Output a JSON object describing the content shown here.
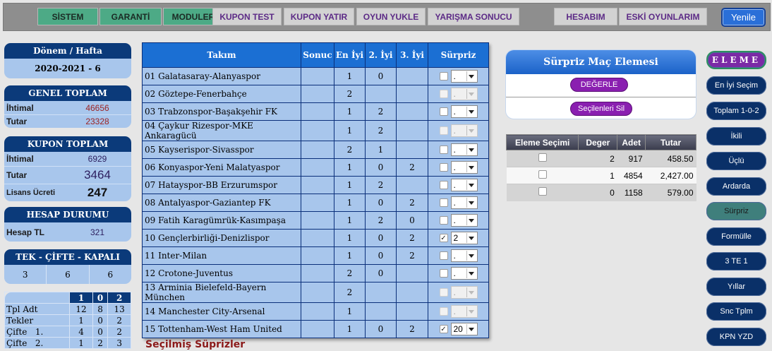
{
  "nav": {
    "left_buttons": [
      {
        "label": "SİSTEM",
        "style": "green"
      },
      {
        "label": "GARANTİ",
        "style": "green"
      },
      {
        "label": "MODULER",
        "style": "green"
      },
      {
        "label": "KUPON TEST",
        "style": "grey"
      },
      {
        "label": "KUPON YATIR",
        "style": "grey"
      },
      {
        "label": "OYUN YUKLE",
        "style": "grey"
      },
      {
        "label": "YARIŞMA SONUCU",
        "style": "grey"
      }
    ],
    "right_buttons": [
      {
        "label": "HESABIM"
      },
      {
        "label": "ESKİ OYUNLARIM"
      }
    ],
    "refresh_label": "Yenile"
  },
  "left": {
    "period": {
      "title": "Dönem / Hafta",
      "value": "2020-2021 - 6"
    },
    "general_total": {
      "title": "GENEL TOPLAM",
      "rows": [
        {
          "key": "İhtimal",
          "value": "46656"
        },
        {
          "key": "Tutar",
          "value": "23328"
        }
      ]
    },
    "coupon_total": {
      "title": "KUPON TOPLAM",
      "rows": [
        {
          "key": "İhtimal",
          "value": "6929"
        },
        {
          "key": "Tutar",
          "value": "3464"
        },
        {
          "key": "Lisans Ücreti",
          "value": "247"
        }
      ]
    },
    "account": {
      "title": "HESAP DURUMU",
      "key": "Hesap TL",
      "value": "321"
    },
    "single_double": {
      "title": "TEK - ÇİFTE - KAPALI",
      "values": [
        "3",
        "6",
        "6"
      ]
    },
    "tpl": {
      "headers": [
        "",
        "1",
        "0",
        "2"
      ],
      "rows": [
        [
          "Tpl Adt",
          "12",
          "8",
          "13"
        ],
        [
          "Tekler",
          "1",
          "0",
          "2"
        ],
        [
          "Çifte   1.",
          "4",
          "0",
          "2"
        ],
        [
          "Çifte   2.",
          "1",
          "2",
          "3"
        ]
      ]
    }
  },
  "main": {
    "headers": [
      "Takım",
      "Sonuc",
      "En İyi",
      "2. İyi",
      "3. İyi",
      "Sürpriz"
    ],
    "rows": [
      {
        "team": "01 Galatasaray-Alanyaspor",
        "sonuc": "",
        "best": "1",
        "second": "0",
        "third": "",
        "checked": false,
        "disabled": false,
        "value": "."
      },
      {
        "team": "02 Göztepe-Fenerbahçe",
        "sonuc": "",
        "best": "2",
        "second": "",
        "third": "",
        "checked": false,
        "disabled": true,
        "value": "."
      },
      {
        "team": "03 Trabzonspor-Başakşehir FK",
        "sonuc": "",
        "best": "1",
        "second": "2",
        "third": "",
        "checked": false,
        "disabled": false,
        "value": "."
      },
      {
        "team": "04 Çaykur Rizespor-MKE Ankaragücü",
        "sonuc": "",
        "best": "1",
        "second": "2",
        "third": "",
        "checked": false,
        "disabled": true,
        "value": "."
      },
      {
        "team": "05 Kayserispor-Sivasspor",
        "sonuc": "",
        "best": "2",
        "second": "1",
        "third": "",
        "checked": false,
        "disabled": false,
        "value": "."
      },
      {
        "team": "06 Konyaspor-Yeni Malatyaspor",
        "sonuc": "",
        "best": "1",
        "second": "0",
        "third": "2",
        "checked": false,
        "disabled": false,
        "value": "."
      },
      {
        "team": "07 Hatayspor-BB Erzurumspor",
        "sonuc": "",
        "best": "1",
        "second": "2",
        "third": "",
        "checked": false,
        "disabled": false,
        "value": "."
      },
      {
        "team": "08 Antalyaspor-Gaziantep FK",
        "sonuc": "",
        "best": "1",
        "second": "0",
        "third": "2",
        "checked": false,
        "disabled": false,
        "value": "."
      },
      {
        "team": "09 Fatih Karagümrük-Kasımpaşa",
        "sonuc": "",
        "best": "1",
        "second": "2",
        "third": "0",
        "checked": false,
        "disabled": false,
        "value": "."
      },
      {
        "team": "10 Gençlerbirliği-Denizlispor",
        "sonuc": "",
        "best": "1",
        "second": "0",
        "third": "2",
        "checked": true,
        "disabled": false,
        "value": "2"
      },
      {
        "team": "11 Inter-Milan",
        "sonuc": "",
        "best": "1",
        "second": "0",
        "third": "2",
        "checked": false,
        "disabled": false,
        "value": "."
      },
      {
        "team": "12 Crotone-Juventus",
        "sonuc": "",
        "best": "2",
        "second": "0",
        "third": "",
        "checked": false,
        "disabled": false,
        "value": "."
      },
      {
        "team": "13 Arminia Bielefeld-Bayern München",
        "sonuc": "",
        "best": "2",
        "second": "",
        "third": "",
        "checked": false,
        "disabled": true,
        "value": "."
      },
      {
        "team": "14 Manchester City-Arsenal",
        "sonuc": "",
        "best": "1",
        "second": "",
        "third": "",
        "checked": false,
        "disabled": true,
        "value": "."
      },
      {
        "team": "15 Tottenham-West Ham United",
        "sonuc": "",
        "best": "1",
        "second": "0",
        "third": "2",
        "checked": true,
        "disabled": false,
        "value": "20"
      }
    ],
    "selected_title": "Seçilmiş Süprizler"
  },
  "surprise_box": {
    "title": "Sürpriz Maç Elemesi",
    "evaluate_label": "DEĞERLE",
    "delete_label": "Seçilenleri Sil"
  },
  "elim_table": {
    "headers": [
      "Eleme Seçimi",
      "Deger",
      "Adet",
      "Tutar"
    ],
    "rows": [
      {
        "deger": "2",
        "adet": "917",
        "tutar": "458.50"
      },
      {
        "deger": "1",
        "adet": "4854",
        "tutar": "2,427.00"
      },
      {
        "deger": "0",
        "adet": "1158",
        "tutar": "579.00"
      }
    ]
  },
  "side_menu": [
    {
      "label": "ELEME",
      "state": "eleme"
    },
    {
      "label": "En İyi Seçim",
      "state": "normal"
    },
    {
      "label": "Toplam 1-0-2",
      "state": "normal"
    },
    {
      "label": "İkili",
      "state": "normal"
    },
    {
      "label": "Üçlü",
      "state": "normal"
    },
    {
      "label": "Ardarda",
      "state": "normal"
    },
    {
      "label": "Sürpriz",
      "state": "active"
    },
    {
      "label": "Formülle",
      "state": "normal"
    },
    {
      "label": "3 TE 1",
      "state": "normal"
    },
    {
      "label": "Yıllar",
      "state": "normal"
    },
    {
      "label": "Snc Tplm",
      "state": "normal"
    },
    {
      "label": "KPN YZD",
      "state": "normal"
    }
  ],
  "colors": {
    "nav_green": "#4daa86",
    "nav_grey": "#d2d2d2",
    "panel_head": "#0b3a7a",
    "panel_body": "#a8c6ec",
    "table_header": "#1b6fd3",
    "purple_pill": "#8a1fb0",
    "side_button": "#0a3068"
  }
}
